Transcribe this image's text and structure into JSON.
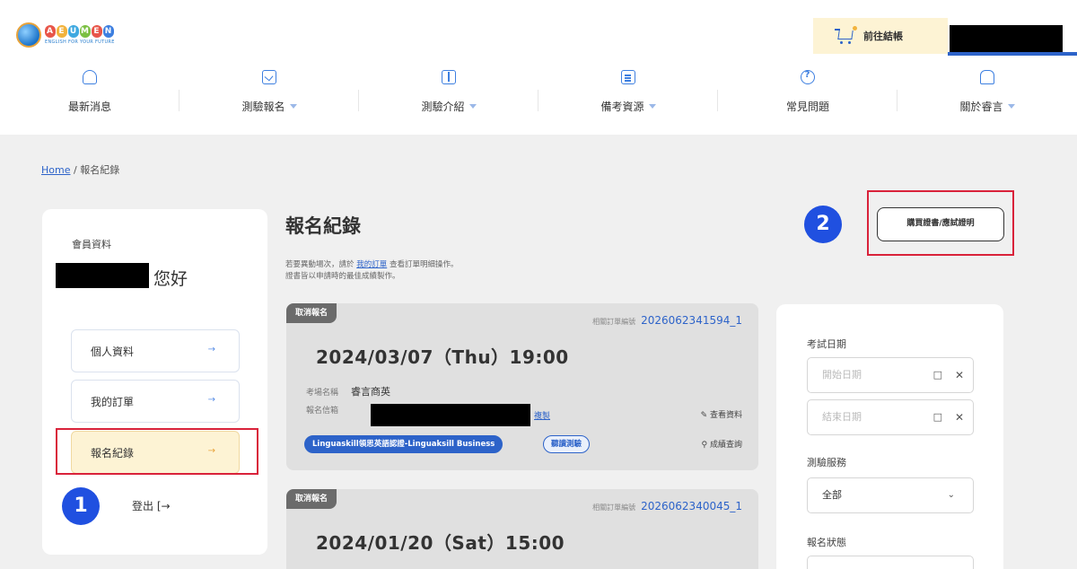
{
  "header": {
    "logo_text": "AEUMEN",
    "logo_tagline": "ENGLISH FOR YOUR FUTURE",
    "cart_label": "前往結帳"
  },
  "nav": [
    {
      "label": "最新消息",
      "icon": "bell-plus-icon",
      "dropdown": false
    },
    {
      "label": "測驗報名",
      "icon": "clipboard-check-icon",
      "dropdown": true
    },
    {
      "label": "測驗介紹",
      "icon": "book-icon",
      "dropdown": true
    },
    {
      "label": "備考資源",
      "icon": "document-icon",
      "dropdown": true
    },
    {
      "label": "常見問題",
      "icon": "question-circle-icon",
      "dropdown": false
    },
    {
      "label": "關於睿言",
      "icon": "building-icon",
      "dropdown": true
    }
  ],
  "breadcrumb": {
    "home": "Home",
    "separator": "/",
    "current": "報名紀錄"
  },
  "sidebar": {
    "title": "會員資料",
    "greeting": "您好",
    "items": [
      {
        "label": "個人資料",
        "arrow": "→"
      },
      {
        "label": "我的訂單",
        "arrow": "→"
      },
      {
        "label": "報名紀錄",
        "arrow": "→"
      }
    ],
    "logout": "登出 [→"
  },
  "annotations": {
    "badge_1": "1",
    "badge_2": "2"
  },
  "main": {
    "title": "報名紀錄",
    "note_prefix": "若要異動場次，請於",
    "note_link": "我的訂單",
    "note_suffix": "查看訂單明細操作。",
    "note_line2": "證書皆以申請時的最佳成績製作。",
    "buy_button": "購買證書/應試證明"
  },
  "records": [
    {
      "tag": "取消報名",
      "order_label": "相關訂單編號",
      "order_no": "2026062341594_1",
      "date": "2024/03/07（Thu）19:00",
      "venue_label": "考場名稱",
      "venue": "睿言商英",
      "email_label": "報名信箱",
      "copy": "複製",
      "view": "查看資料",
      "exam_tag": "Linguaskill領思英語認證-Linguaksill Business",
      "type_tag": "聽讀測驗",
      "score": "成績查詢"
    },
    {
      "tag": "取消報名",
      "order_label": "相關訂單編號",
      "order_no": "2026062340045_1",
      "date": "2024/01/20（Sat）15:00"
    }
  ],
  "filter": {
    "date_label": "考試日期",
    "start_placeholder": "開始日期",
    "end_placeholder": "結束日期",
    "service_label": "測驗服務",
    "service_value": "全部",
    "status_label": "報名狀態"
  },
  "colors": {
    "accent": "#2d63c9",
    "highlight": "#fdf3d4",
    "annotation_red": "#d9223a",
    "badge_blue": "#2050e0"
  }
}
